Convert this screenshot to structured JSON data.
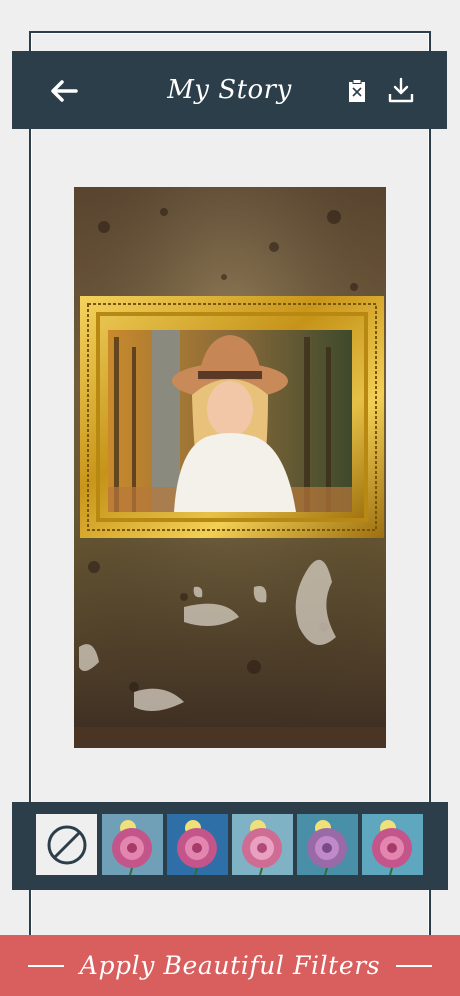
{
  "header": {
    "title": "My Story",
    "back_icon": "arrow-left-icon",
    "clipboard_icon": "clipboard-clear-icon",
    "download_icon": "download-icon"
  },
  "filters": {
    "items": [
      {
        "name": "none",
        "icon": "no-filter-icon"
      },
      {
        "name": "filter-1",
        "tint": "#6fa0b8"
      },
      {
        "name": "filter-2",
        "tint": "#2f6fa8"
      },
      {
        "name": "filter-3",
        "tint": "#7fb2c4"
      },
      {
        "name": "filter-4",
        "tint": "#4a8fa8"
      },
      {
        "name": "filter-5",
        "tint": "#5fa6bf"
      }
    ]
  },
  "footer": {
    "caption": "Apply Beautiful Filters"
  },
  "colors": {
    "header_bg": "#2b3e4a",
    "footer_bg": "#d95f5f",
    "page_bg": "#efefef",
    "frame_gold": "#d4a21c"
  }
}
